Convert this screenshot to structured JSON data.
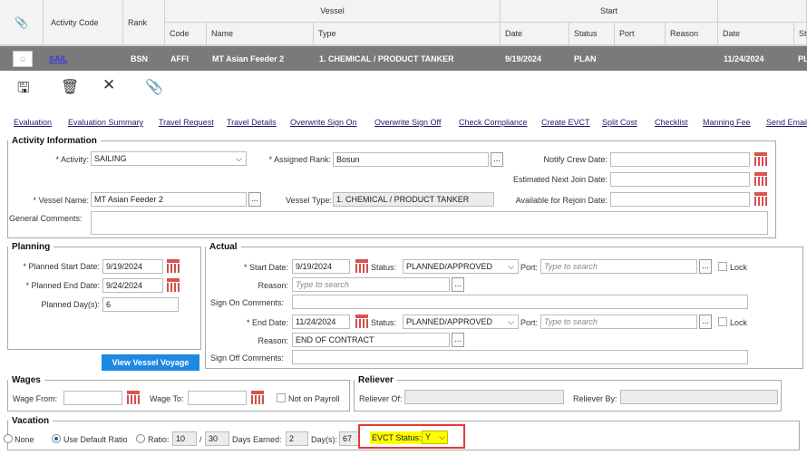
{
  "grid": {
    "headers": {
      "activity_code": "Activity Code",
      "rank": "Rank",
      "vessel": "Vessel",
      "start": "Start",
      "code": "Code",
      "name": "Name",
      "type": "Type",
      "date": "Date",
      "status": "Status",
      "port": "Port",
      "reason": "Reason",
      "date2": "Date",
      "st": "St"
    },
    "row": {
      "activity_code": "SAIL",
      "rank": "BSN",
      "code": "AFFI",
      "name": "MT Asian Feeder 2",
      "type": "1. CHEMICAL / PRODUCT TANKER",
      "start_date": "9/19/2024",
      "status": "PLAN",
      "date2": "11/24/2024",
      "st": "PL"
    }
  },
  "links": [
    "Evaluation",
    "Evaluation Summary",
    "Travel Request",
    "Travel Details",
    "Overwrite Sign On",
    "Overwrite Sign Off",
    "Check Compliance",
    "Create EVCT",
    "Split Cost",
    "Checklist",
    "Manning Fee",
    "Send Email"
  ],
  "activity_info": {
    "legend": "Activity Information",
    "activity_label": "* Activity:",
    "activity_value": "SAILING",
    "assigned_rank_label": "* Assigned Rank:",
    "assigned_rank_value": "Bosun",
    "notify_label": "Notify Crew Date:",
    "est_next_label": "Estimated Next Join Date:",
    "vessel_name_label": "* Vessel Name:",
    "vessel_name_value": "MT Asian Feeder 2",
    "vessel_type_label": "Vessel Type:",
    "vessel_type_value": "1. CHEMICAL / PRODUCT TANKER",
    "rejoin_label": "Available for Rejoin Date:",
    "comments_label": "General Comments:"
  },
  "planning": {
    "legend": "Planning",
    "start_label": "* Planned Start Date:",
    "start_value": "9/19/2024",
    "end_label": "* Planned End Date:",
    "end_value": "9/24/2024",
    "days_label": "Planned Day(s):",
    "days_value": "6",
    "button": "View Vessel Voyage"
  },
  "actual": {
    "legend": "Actual",
    "start_label": "* Start Date:",
    "start_value": "9/19/2024",
    "status_label": "Status:",
    "start_status": "PLANNED/APPROVED",
    "port_label": "Port:",
    "port_placeholder": "Type to search",
    "lock_label": "Lock",
    "reason_label": "Reason:",
    "reason_placeholder": "Type to search",
    "sign_on_label": "Sign On Comments:",
    "end_label": "* End Date:",
    "end_value": "11/24/2024",
    "end_status": "PLANNED/APPROVED",
    "end_reason_value": "END OF CONTRACT",
    "sign_off_label": "Sign Off Comments:"
  },
  "wages": {
    "legend": "Wages",
    "from_label": "Wage From:",
    "to_label": "Wage To:",
    "payroll_label": "Not on Payroll"
  },
  "reliever": {
    "legend": "Reliever",
    "of_label": "Reliever Of:",
    "by_label": "Reliever By:"
  },
  "vacation": {
    "legend": "Vacation",
    "none_label": "None",
    "default_label": "Use Default Ratio",
    "ratio_label": "Ratio:",
    "ratio_a": "10",
    "ratio_sep": "/",
    "ratio_b": "30",
    "earned_label": "Days Earned:",
    "earned_value": "2",
    "days_label": "Day(s):",
    "days_value": "67",
    "evct_label": "EVCT Status:",
    "evct_value": "Y"
  },
  "colors": {
    "header_bg": "#f3f3f3",
    "row_bg": "#7a7a7a",
    "button_blue": "#1e88e5",
    "highlight": "#ffff00",
    "outline_red": "#e53935"
  }
}
